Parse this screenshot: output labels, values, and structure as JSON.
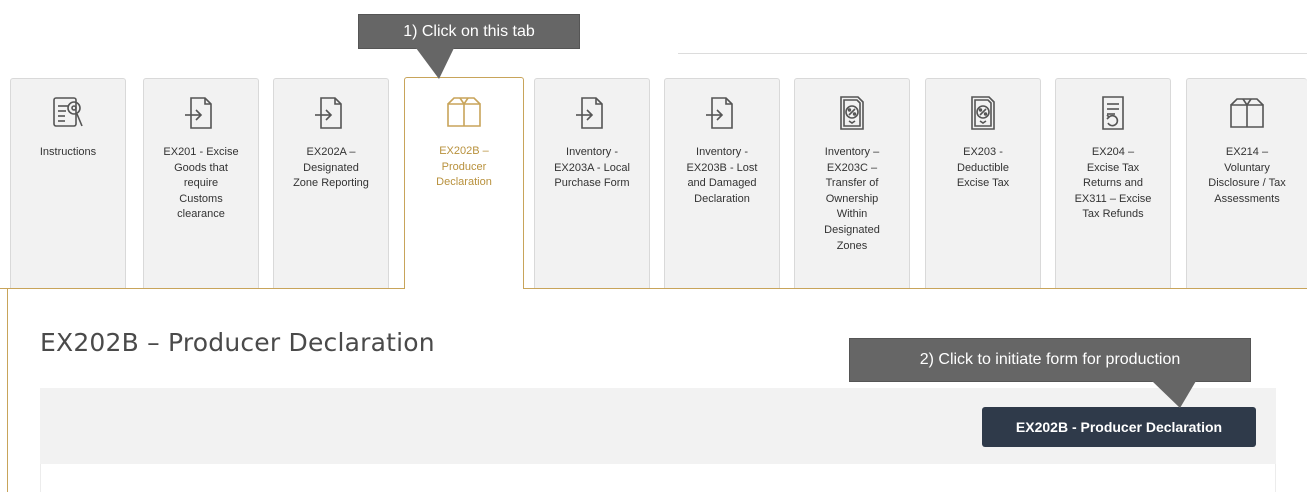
{
  "annotations": {
    "step1": "1) Click on this tab",
    "step2": "2) Click to initiate form for production"
  },
  "tabs": [
    {
      "label": "Instructions",
      "icon": "instructions-icon"
    },
    {
      "label": "EX201 - Excise\nGoods that\nrequire\nCustoms\nclearance",
      "icon": "arrow-into-document-icon"
    },
    {
      "label": "EX202A –\nDesignated\nZone Reporting",
      "icon": "arrow-into-document-icon"
    },
    {
      "label": "EX202B –\nProducer\nDeclaration",
      "icon": "box-icon",
      "active": true
    },
    {
      "label": "Inventory -\nEX203A - Local\nPurchase Form",
      "icon": "arrow-into-document-icon"
    },
    {
      "label": "Inventory -\nEX203B - Lost\nand Damaged\nDeclaration",
      "icon": "arrow-into-document-icon"
    },
    {
      "label": "Inventory –\nEX203C –\nTransfer of\nOwnership\nWithin\nDesignated\nZones",
      "icon": "percent-document-icon"
    },
    {
      "label": "EX203 -\nDeductible\nExcise Tax",
      "icon": "percent-document-icon"
    },
    {
      "label": "EX204 –\nExcise Tax\nReturns and\nEX311 – Excise\nTax Refunds",
      "icon": "return-document-icon"
    },
    {
      "label": "EX214 –\nVoluntary\nDisclosure / Tax\nAssessments",
      "icon": "box-icon"
    }
  ],
  "section": {
    "title": "EX202B – Producer Declaration",
    "button_label": "EX202B - Producer Declaration"
  },
  "colors": {
    "accent": "#c8a45a",
    "active_text": "#b8913d",
    "button_bg": "#2f3a4a",
    "callout_bg": "#666666"
  }
}
